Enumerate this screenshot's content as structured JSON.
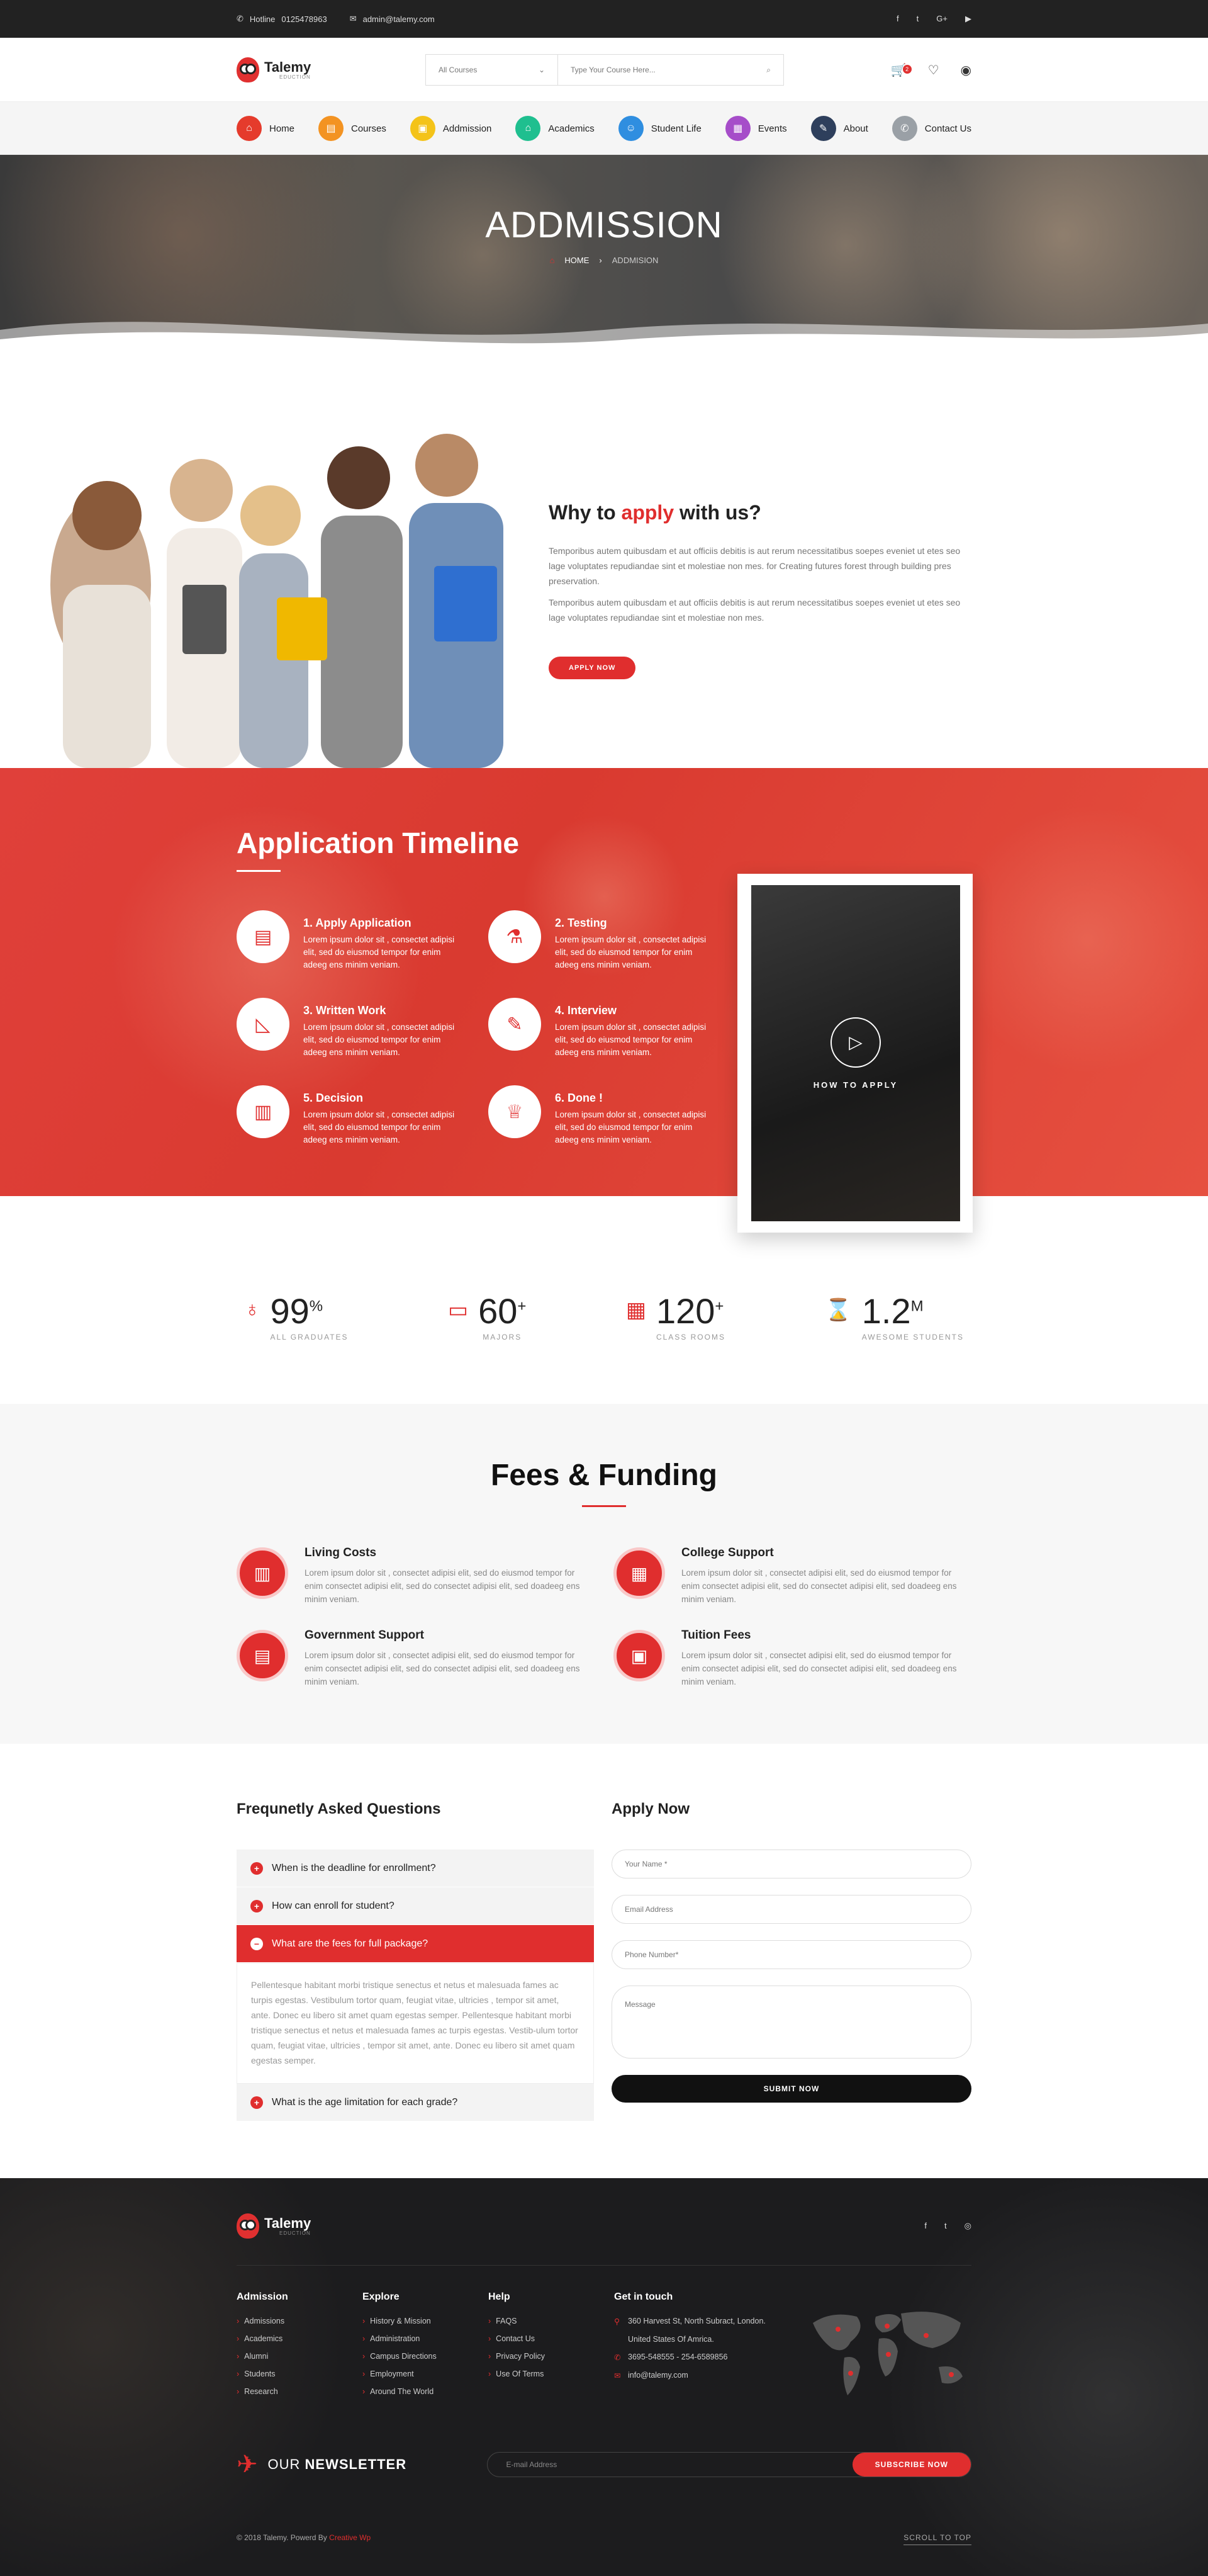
{
  "topbar": {
    "hotline_label": "Hotline",
    "hotline_number": "0125478963",
    "email": "admin@talemy.com",
    "social": [
      "f",
      "t",
      "G+",
      "▶"
    ]
  },
  "header": {
    "logo_name": "Talemy",
    "logo_sub": "EDUCTION",
    "course_select": "All Courses",
    "search_placeholder": "Type Your Course Here...",
    "cart_count": "2"
  },
  "nav": [
    {
      "label": "Home",
      "icon": "home-icon",
      "color": "#e53b2c"
    },
    {
      "label": "Courses",
      "icon": "book-icon",
      "color": "#f39322"
    },
    {
      "label": "Addmission",
      "icon": "admission-icon",
      "color": "#f4c319"
    },
    {
      "label": "Academics",
      "icon": "academics-icon",
      "color": "#1fbf8f"
    },
    {
      "label": "Student Life",
      "icon": "student-icon",
      "color": "#2f8ee0"
    },
    {
      "label": "Events",
      "icon": "events-icon",
      "color": "#a64dc9"
    },
    {
      "label": "About",
      "icon": "about-icon",
      "color": "#2e3f5c"
    },
    {
      "label": "Contact Us",
      "icon": "phone-icon",
      "color": "#9aa0a6"
    }
  ],
  "hero": {
    "title": "ADDMISSION",
    "crumb_home": "HOME",
    "crumb_current": "ADDMISION"
  },
  "why": {
    "title_pre": "Why to",
    "title_hl": "apply",
    "title_post": "with us?",
    "p1": "Temporibus autem quibusdam et aut officiis debitis is aut rerum necessitatibus soepes eveniet ut etes seo lage voluptates repudiandae sint et molestiae non mes. for Creating  futures forest through building pres preservation.",
    "p2": "Temporibus autem quibusdam et aut officiis debitis is aut rerum necessitatibus soepes eveniet ut etes seo lage voluptates repudiandae sint et molestiae non mes.",
    "button": "APPLY NOW"
  },
  "timeline": {
    "title": "Application Timeline",
    "steps": [
      {
        "title": "1. Apply Application",
        "text": "Lorem ipsum dolor sit , consectet adipisi elit, sed do eiusmod tempor for enim adeeg ens minim veniam."
      },
      {
        "title": "2. Testing",
        "text": "Lorem ipsum dolor sit , consectet adipisi elit, sed do eiusmod tempor for enim adeeg ens minim veniam."
      },
      {
        "title": "3. Written Work",
        "text": "Lorem ipsum dolor sit , consectet adipisi elit, sed do eiusmod tempor for enim adeeg ens minim veniam."
      },
      {
        "title": "4. Interview",
        "text": "Lorem ipsum dolor sit , consectet adipisi elit, sed do eiusmod tempor for enim adeeg ens minim veniam."
      },
      {
        "title": "5. Decision",
        "text": "Lorem ipsum dolor sit , consectet adipisi elit, sed do eiusmod tempor for enim adeeg ens minim veniam."
      },
      {
        "title": "6. Done !",
        "text": "Lorem ipsum dolor sit , consectet adipisi elit, sed do eiusmod tempor for enim adeeg ens minim veniam."
      }
    ],
    "video_label": "HOW TO APPLY"
  },
  "stats": [
    {
      "num": "99",
      "sup": "%",
      "label": "ALL GRADUATES"
    },
    {
      "num": "60",
      "sup": "+",
      "label": "MAJORS"
    },
    {
      "num": "120",
      "sup": "+",
      "label": "CLASS ROOMS"
    },
    {
      "num": "1.2",
      "sup": "M",
      "label": "AWESOME STUDENTS"
    }
  ],
  "fees": {
    "title": "Fees & Funding",
    "items": [
      {
        "title": "Living Costs",
        "text": "Lorem ipsum dolor sit , consectet adipisi elit, sed do eiusmod tempor for enim consectet adipisi elit, sed do consectet adipisi elit, sed doadeeg ens minim veniam."
      },
      {
        "title": "College Support",
        "text": "Lorem ipsum dolor sit , consectet adipisi elit, sed do eiusmod tempor for enim consectet adipisi elit, sed do consectet adipisi elit, sed doadeeg ens minim veniam."
      },
      {
        "title": "Government Support",
        "text": "Lorem ipsum dolor sit , consectet adipisi elit, sed do eiusmod tempor for enim consectet adipisi elit, sed do consectet adipisi elit, sed doadeeg ens minim veniam."
      },
      {
        "title": "Tuition Fees",
        "text": "Lorem ipsum dolor sit , consectet adipisi elit, sed do eiusmod tempor for enim consectet adipisi elit, sed do consectet adipisi elit, sed doadeeg ens minim veniam."
      }
    ]
  },
  "faq": {
    "title": "Frequnetly Asked Questions",
    "q1": "When is the deadline for enrollment?",
    "q2": "How can enroll for student?",
    "q3": "What are the fees for full package?",
    "answer": "Pellentesque habitant morbi tristique senectus et netus et malesuada fames ac turpis egestas. Vestibulum tortor quam, feugiat vitae, ultricies , tempor sit amet, ante. Donec eu libero sit amet quam egestas semper. Pellentesque habitant morbi tristique senectus et netus et malesuada fames ac turpis egestas. Vestib-ulum tortor quam, feugiat vitae, ultricies , tempor sit amet, ante. Donec eu libero sit amet quam egestas semper.",
    "q4": "What is the age limitation for each grade?"
  },
  "apply": {
    "title": "Apply Now",
    "name": "Your Name *",
    "email": "Email Address",
    "phone": "Phone Number*",
    "message": "Message",
    "submit": "SUBMIT NOW"
  },
  "footer": {
    "logo_name": "Talemy",
    "logo_sub": "EDUCTION",
    "social": [
      "f",
      "t",
      "◎"
    ],
    "cols": [
      {
        "title": "Admission",
        "items": [
          "Admissions",
          "Academics",
          "Alumni",
          "Students",
          "Research"
        ]
      },
      {
        "title": "Explore",
        "items": [
          "History & Mission",
          "Administration",
          "Campus Directions",
          "Employment",
          "Around The World"
        ]
      },
      {
        "title": "Help",
        "items": [
          "FAQS",
          "Contact Us",
          "Privacy Policy",
          "Use Of Terms"
        ]
      }
    ],
    "contact_title": "Get in touch",
    "address1": "360 Harvest St, North Subract, London.",
    "address2": "United States Of Amrica.",
    "phones": "3695-548555    -    254-6589856",
    "email": "info@talemy.com",
    "newsletter_pre": "OUR",
    "newsletter_bold": "NEWSLETTER",
    "newsletter_placeholder": "E-mail Address",
    "subscribe": "SUBSCRIBE NOW",
    "copyright": "© 2018 Talemy.  Powerd By",
    "copyright_link": "Creative Wp",
    "scroll": "SCROLL TO TOP"
  }
}
